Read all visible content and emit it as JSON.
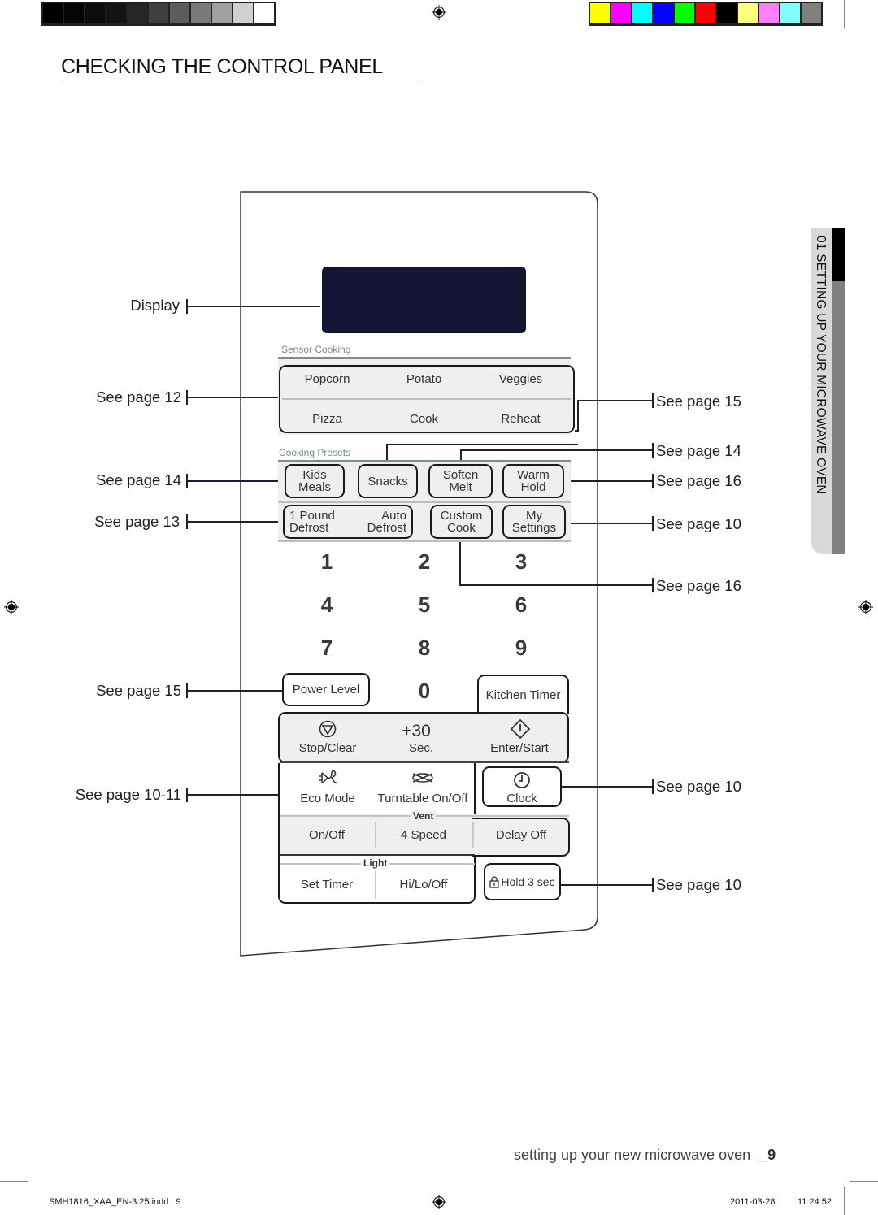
{
  "header": {
    "title": "CHECKING THE CONTROL PANEL",
    "grayscale_bar": [
      "#000000",
      "#050505",
      "#0c0c0c",
      "#141414",
      "#262626",
      "#404040",
      "#5c5c5c",
      "#7a7a7a",
      "#a0a0a0",
      "#d0d0d0",
      "#ffffff"
    ],
    "color_bar": [
      "#ffff00",
      "#ff00ff",
      "#00ffff",
      "#0000ff",
      "#00ff00",
      "#ff0000",
      "#000000",
      "#ffff80",
      "#ff80ff",
      "#80ffff",
      "#808080"
    ]
  },
  "side_tab": {
    "label": "01 SETTING UP YOUR MICROWAVE OVEN"
  },
  "panel": {
    "display_color": "#141535",
    "sensor_cooking": {
      "label": "Sensor Cooking",
      "row1": [
        "Popcorn",
        "Potato",
        "Veggies"
      ],
      "row2": [
        "Pizza",
        "Cook",
        "Reheat"
      ]
    },
    "cooking_presets": {
      "label": "Cooking Presets",
      "row1": [
        {
          "line1": "Kids",
          "line2": "Meals"
        },
        {
          "line1": "Snacks",
          "line2": ""
        },
        {
          "line1": "Soften",
          "line2": "Melt"
        },
        {
          "line1": "Warm",
          "line2": "Hold"
        }
      ],
      "defrost": {
        "left_line1": "1 Pound",
        "left_line2": "Defrost",
        "right_line1": "Auto",
        "right_line2": "Defrost"
      },
      "custom_cook": {
        "line1": "Custom",
        "line2": "Cook"
      },
      "my_settings": {
        "line1": "My",
        "line2": "Settings"
      }
    },
    "keypad": [
      "1",
      "2",
      "3",
      "4",
      "5",
      "6",
      "7",
      "8",
      "9",
      "0"
    ],
    "power_level": "Power Level",
    "kitchen_timer": "Kitchen Timer",
    "stop_clear": "Stop/Clear",
    "plus30": "+30",
    "plus30_sub": "Sec.",
    "enter_start": "Enter/Start",
    "eco_mode": "Eco Mode",
    "turntable": "Turntable On/Off",
    "clock": "Clock",
    "vent": {
      "label": "Vent",
      "items": [
        "On/Off",
        "4 Speed",
        "Delay Off"
      ]
    },
    "light": {
      "label": "Light",
      "items": [
        "Set Timer",
        "Hi/Lo/Off"
      ]
    },
    "lock": "Hold 3 sec"
  },
  "callouts": {
    "left": [
      "Display",
      "See page 12",
      "See page 14",
      "See page 13",
      "See page 15",
      "See page 10-11"
    ],
    "right": [
      "See page 15",
      "See page 14",
      "See page 16",
      "See page 10",
      "See page 16",
      "See page 10",
      "See page 10"
    ]
  },
  "footer": {
    "page_caption": "setting up your new microwave oven",
    "page_number": "_9",
    "slug_file": "SMH1816_XAA_EN-3.25.indd   9",
    "slug_date": "2011-03-28",
    "slug_time": "11:24:52"
  }
}
